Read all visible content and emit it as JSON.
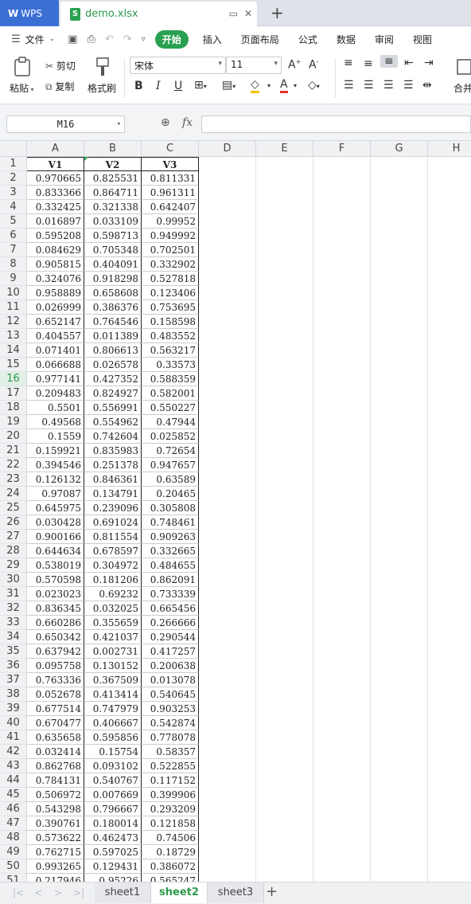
{
  "title_bar": {
    "app_label": "WPS",
    "doc_name": "demo.xlsx"
  },
  "menu": {
    "file": "文件",
    "items": [
      "开始",
      "插入",
      "页面布局",
      "公式",
      "数据",
      "审阅",
      "视图"
    ]
  },
  "ribbon": {
    "paste": "粘贴",
    "cut": "剪切",
    "copy": "复制",
    "format_painter": "格式刷",
    "font_name": "宋体",
    "font_size": "11",
    "merge": "合并"
  },
  "formula_bar": {
    "cell_ref": "M16",
    "fx": "fx",
    "formula": ""
  },
  "grid": {
    "columns": [
      "A",
      "B",
      "C",
      "D",
      "E",
      "F",
      "G",
      "H"
    ],
    "headers": [
      "V1",
      "V2",
      "V3"
    ],
    "selected_row": 16,
    "rows": [
      [
        "0.970665",
        "0.825531",
        "0.811331"
      ],
      [
        "0.833366",
        "0.864711",
        "0.961311"
      ],
      [
        "0.332425",
        "0.321338",
        "0.642407"
      ],
      [
        "0.016897",
        "0.033109",
        "0.99952"
      ],
      [
        "0.595208",
        "0.598713",
        "0.949992"
      ],
      [
        "0.084629",
        "0.705348",
        "0.702501"
      ],
      [
        "0.905815",
        "0.404091",
        "0.332902"
      ],
      [
        "0.324076",
        "0.918298",
        "0.527818"
      ],
      [
        "0.958889",
        "0.658608",
        "0.123406"
      ],
      [
        "0.026999",
        "0.386376",
        "0.753695"
      ],
      [
        "0.652147",
        "0.764546",
        "0.158598"
      ],
      [
        "0.404557",
        "0.011389",
        "0.483552"
      ],
      [
        "0.071401",
        "0.806613",
        "0.563217"
      ],
      [
        "0.066688",
        "0.026578",
        "0.33573"
      ],
      [
        "0.977141",
        "0.427352",
        "0.588359"
      ],
      [
        "0.209483",
        "0.824927",
        "0.582001"
      ],
      [
        "0.5501",
        "0.556991",
        "0.550227"
      ],
      [
        "0.49568",
        "0.554962",
        "0.47944"
      ],
      [
        "0.1559",
        "0.742604",
        "0.025852"
      ],
      [
        "0.159921",
        "0.835983",
        "0.72654"
      ],
      [
        "0.394546",
        "0.251378",
        "0.947657"
      ],
      [
        "0.126132",
        "0.846361",
        "0.63589"
      ],
      [
        "0.97087",
        "0.134791",
        "0.20465"
      ],
      [
        "0.645975",
        "0.239096",
        "0.305808"
      ],
      [
        "0.030428",
        "0.691024",
        "0.748461"
      ],
      [
        "0.900166",
        "0.811554",
        "0.909263"
      ],
      [
        "0.644634",
        "0.678597",
        "0.332665"
      ],
      [
        "0.538019",
        "0.304972",
        "0.484655"
      ],
      [
        "0.570598",
        "0.181206",
        "0.862091"
      ],
      [
        "0.023023",
        "0.69232",
        "0.733339"
      ],
      [
        "0.836345",
        "0.032025",
        "0.665456"
      ],
      [
        "0.660286",
        "0.355659",
        "0.266666"
      ],
      [
        "0.650342",
        "0.421037",
        "0.290544"
      ],
      [
        "0.637942",
        "0.002731",
        "0.417257"
      ],
      [
        "0.095758",
        "0.130152",
        "0.200638"
      ],
      [
        "0.763336",
        "0.367509",
        "0.013078"
      ],
      [
        "0.052678",
        "0.413414",
        "0.540645"
      ],
      [
        "0.677514",
        "0.747979",
        "0.903253"
      ],
      [
        "0.670477",
        "0.406667",
        "0.542874"
      ],
      [
        "0.635658",
        "0.595856",
        "0.778078"
      ],
      [
        "0.032414",
        "0.15754",
        "0.58357"
      ],
      [
        "0.862768",
        "0.093102",
        "0.522855"
      ],
      [
        "0.784131",
        "0.540767",
        "0.117152"
      ],
      [
        "0.506972",
        "0.007669",
        "0.399906"
      ],
      [
        "0.543298",
        "0.796667",
        "0.293209"
      ],
      [
        "0.390761",
        "0.180014",
        "0.121858"
      ],
      [
        "0.573622",
        "0.462473",
        "0.74506"
      ],
      [
        "0.762715",
        "0.597025",
        "0.18729"
      ],
      [
        "0.993265",
        "0.129431",
        "0.386072"
      ],
      [
        "0.217946",
        "0.95226",
        "0.565247"
      ]
    ]
  },
  "sheets": {
    "tabs": [
      "sheet1",
      "sheet2",
      "sheet3"
    ],
    "active": 1
  },
  "colors": {
    "accent": "#2aa051",
    "wps_blue": "#3b6fd4"
  }
}
